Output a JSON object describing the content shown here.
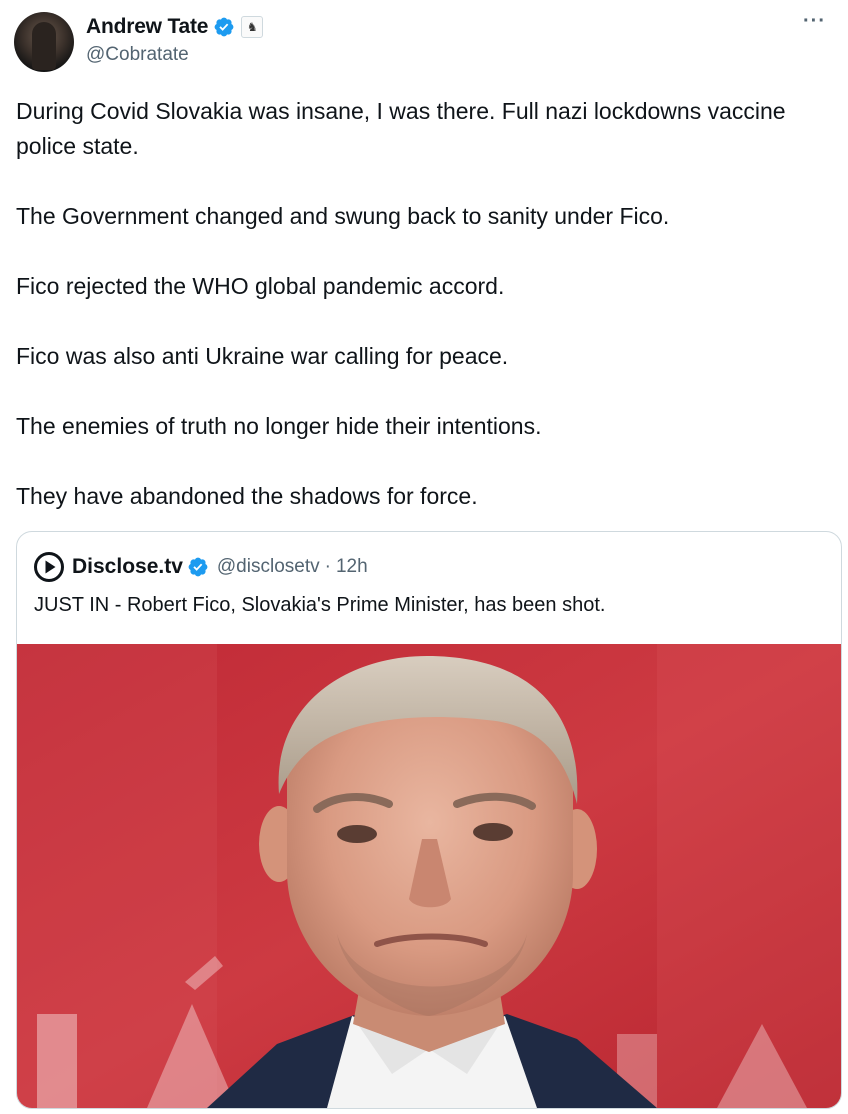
{
  "author": {
    "display_name": "Andrew Tate",
    "handle": "@Cobratate",
    "verified_icon": "verified-badge-icon",
    "affiliate_icon": "chess-knight-affiliate-icon",
    "affiliate_glyph": "♞"
  },
  "more_button": {
    "glyph": "···"
  },
  "tweet": {
    "paragraphs": [
      "During Covid Slovakia was insane, I was there. Full nazi lockdowns vaccine police state.",
      "The Government changed and swung back to sanity under Fico.",
      "Fico rejected the WHO global pandemic accord.",
      "Fico was also anti Ukraine war calling for peace.",
      "The enemies of truth no longer hide their intentions.",
      "They have abandoned the shadows for force."
    ]
  },
  "quoted_tweet": {
    "display_name": "Disclose.tv",
    "handle": "@disclosetv",
    "separator": "·",
    "time": "12h",
    "text": "JUST IN - Robert Fico, Slovakia's Prime Minister, has been shot.",
    "logo_icon": "disclose-play-logo-icon",
    "photo_subject": "portrait-photo"
  },
  "colors": {
    "verified_blue": "#1d9bf0",
    "secondary_text": "#536471",
    "photo_background_red": "#c8303a",
    "border": "#cfd9de"
  }
}
